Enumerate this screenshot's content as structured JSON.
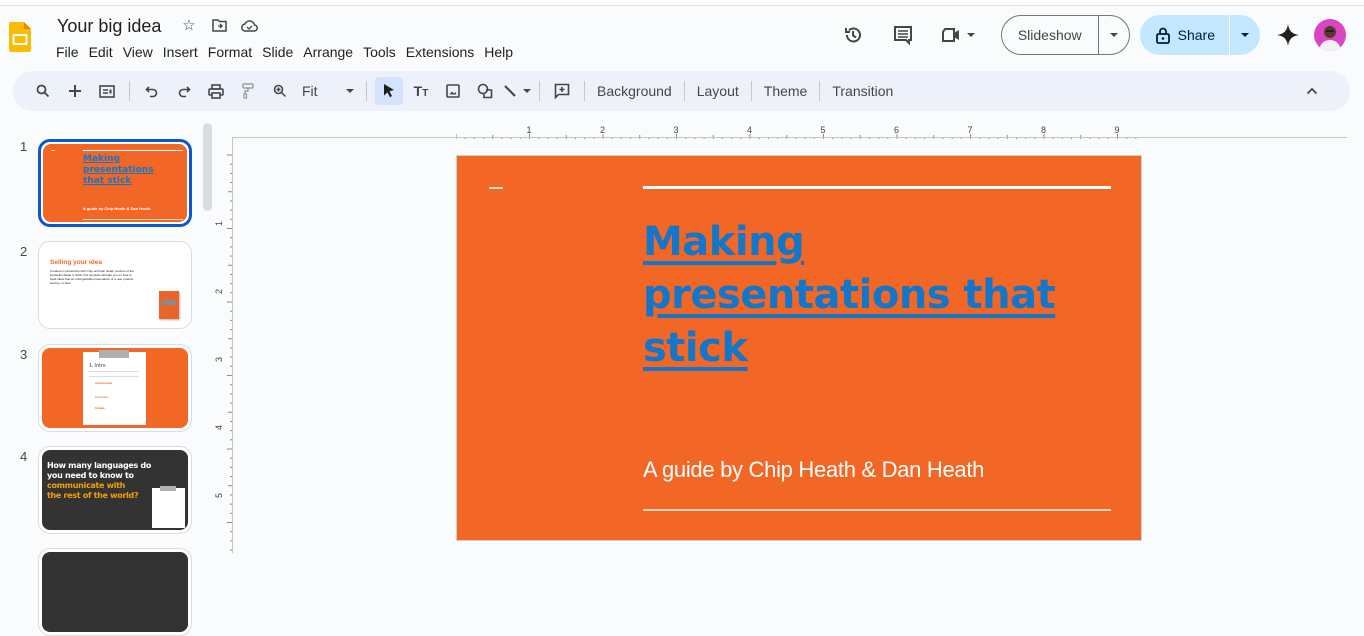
{
  "app": {
    "doc_title": "Your big idea",
    "menu": [
      "File",
      "Edit",
      "View",
      "Insert",
      "Format",
      "Slide",
      "Arrange",
      "Tools",
      "Extensions",
      "Help"
    ]
  },
  "header": {
    "slideshow_label": "Slideshow",
    "share_label": "Share",
    "colors": {
      "share_bg": "#c2e7ff",
      "accent": "#0b57d0"
    }
  },
  "toolbar": {
    "zoom_label": "Fit",
    "background_label": "Background",
    "layout_label": "Layout",
    "theme_label": "Theme",
    "transition_label": "Transition"
  },
  "rulers": {
    "horizontal_ticks": [
      "1",
      "2",
      "3",
      "4",
      "5",
      "6",
      "7",
      "8",
      "9"
    ],
    "vertical_ticks": [
      "1",
      "2",
      "3",
      "4",
      "5"
    ]
  },
  "filmstrip": {
    "slides": [
      {
        "number": "1",
        "title": "Making presentations that stick",
        "subtitle": "A guide by Chip Heath & Dan Heath",
        "selected": true
      },
      {
        "number": "2",
        "title": "Selling your idea",
        "body": "Created in partnership with Chip and Dan Heath, authors of the bestseller Made to Stick; this template will take you on how to build ideas that an unforgettable presentation of a new product, service, or idea."
      },
      {
        "number": "3",
        "title": "1. Intro",
        "items": [
          "Unexpected",
          "Concrete",
          "Simple"
        ]
      },
      {
        "number": "4",
        "title_line1": "How many languages do",
        "title_line2": "you need to know to",
        "title_line3": "communicate with",
        "title_line4": "the rest of the world?"
      }
    ]
  },
  "slide": {
    "title": "Making presentations that stick",
    "subtitle": "A guide by Chip Heath & Dan Heath",
    "colors": {
      "background": "#f26725",
      "title": "#1376c9",
      "subtitle": "#ffffff"
    }
  }
}
